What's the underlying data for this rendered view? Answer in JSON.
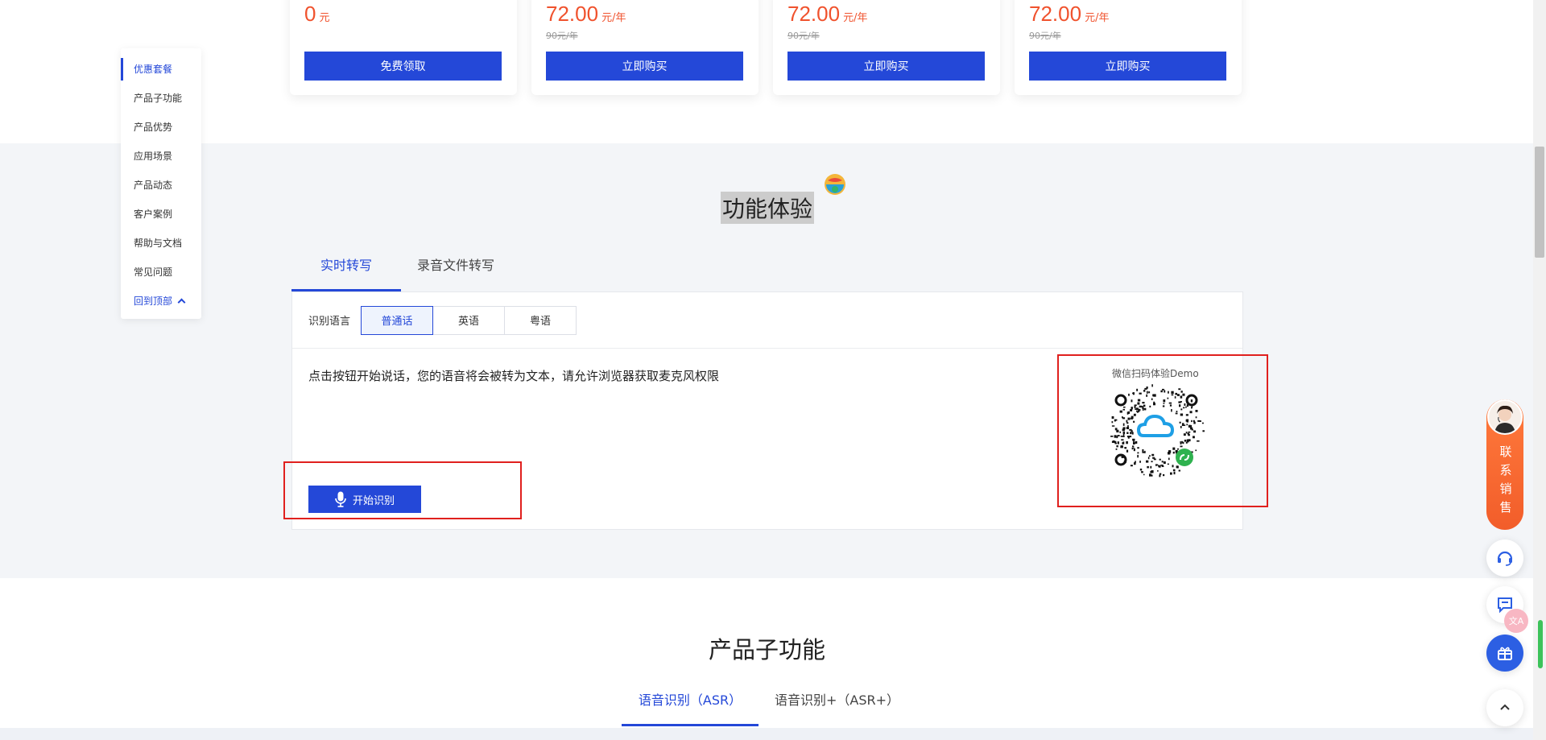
{
  "pricing": {
    "cards": [
      {
        "price": "0",
        "unit": "元",
        "original": "",
        "button": "免费领取"
      },
      {
        "price": "72.00",
        "unit": "元/年",
        "original": "90元/年",
        "button": "立即购买"
      },
      {
        "price": "72.00",
        "unit": "元/年",
        "original": "90元/年",
        "button": "立即购买"
      },
      {
        "price": "72.00",
        "unit": "元/年",
        "original": "90元/年",
        "button": "立即购买"
      }
    ]
  },
  "side_nav": {
    "items": [
      {
        "label": "优惠套餐"
      },
      {
        "label": "产品子功能"
      },
      {
        "label": "产品优势"
      },
      {
        "label": "应用场景"
      },
      {
        "label": "产品动态"
      },
      {
        "label": "客户案例"
      },
      {
        "label": "帮助与文档"
      },
      {
        "label": "常见问题"
      }
    ],
    "back_to_top": "回到顶部"
  },
  "experience": {
    "title": "功能体验",
    "tabs": [
      {
        "label": "实时转写"
      },
      {
        "label": "录音文件转写"
      }
    ],
    "language_label": "识别语言",
    "languages": [
      {
        "label": "普通话"
      },
      {
        "label": "英语"
      },
      {
        "label": "粤语"
      }
    ],
    "hint": "点击按钮开始说话，您的语音将会被转为文本，请允许浏览器获取麦克风权限",
    "start_button": "开始识别",
    "qr_label": "微信扫码体验Demo"
  },
  "sub_functions": {
    "title": "产品子功能",
    "tabs": [
      {
        "label": "语音识别（ASR）"
      },
      {
        "label": "语音识别+（ASR+）"
      }
    ]
  },
  "floating": {
    "contact_sales": "联系销售",
    "translate_badge": "文A"
  },
  "colors": {
    "brand_blue": "#2448d8",
    "price_red": "#f0522d",
    "contact_orange": "#f25d2a",
    "highlight_red": "#e0201e"
  }
}
